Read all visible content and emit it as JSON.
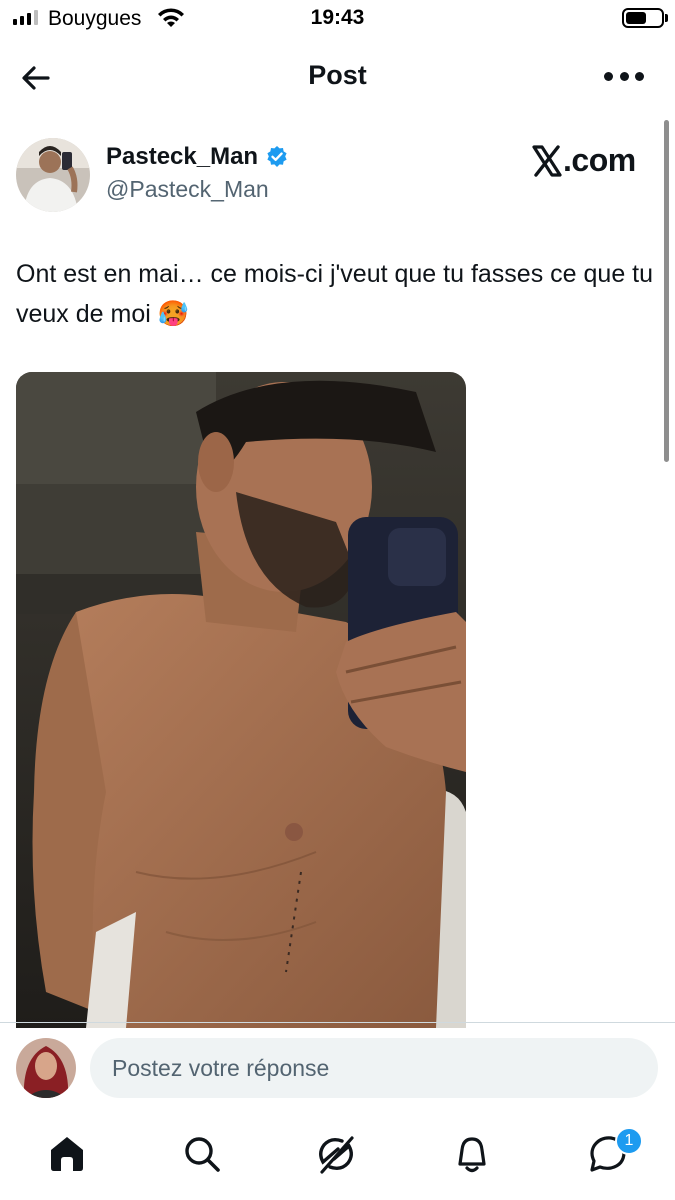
{
  "status_bar": {
    "carrier": "Bouygues",
    "time": "19:43",
    "battery_level": 0.6,
    "signal_bars": 3
  },
  "header": {
    "title": "Post",
    "back_icon": "arrow-left-icon",
    "more_icon": "more-horizontal-icon"
  },
  "tweet": {
    "author_name": "Pasteck_Man",
    "author_handle": "@Pasteck_Man",
    "verified": true,
    "verified_color": "#1d9bf0",
    "text": "Ont est en mai… ce mois-ci j'veut que tu fasses ce que tu veux de moi 🥵",
    "media_description": "mirror-selfie-photo"
  },
  "watermark": {
    "label": ".com"
  },
  "reply": {
    "placeholder": "Postez votre réponse"
  },
  "tabbar": {
    "items": [
      {
        "icon": "home-icon",
        "active": true
      },
      {
        "icon": "search-icon"
      },
      {
        "icon": "grok-icon"
      },
      {
        "icon": "bell-icon"
      },
      {
        "icon": "messages-icon",
        "badge": "1"
      }
    ]
  },
  "colors": {
    "accent": "#1d9bf0",
    "text_primary": "#0f1419",
    "text_secondary": "#536471",
    "input_bg": "#eff3f4"
  }
}
